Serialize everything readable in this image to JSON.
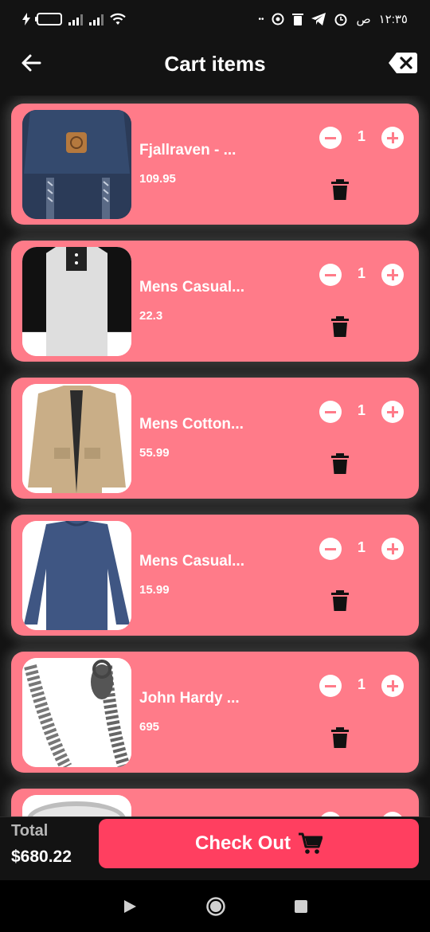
{
  "status_bar": {
    "battery": "11",
    "time": "١٢:٣٥",
    "period": "ص",
    "dots": "••"
  },
  "header": {
    "title": "Cart items",
    "back_icon": "arrow-left-icon",
    "clear_icon": "backspace-x-icon"
  },
  "cart_items": [
    {
      "title": "Fjallraven - ...",
      "price": "109.95",
      "quantity": "1",
      "image": "backpack"
    },
    {
      "title": "Mens Casual...",
      "price": "22.3",
      "quantity": "1",
      "image": "raglan-tshirt"
    },
    {
      "title": "Mens Cotton...",
      "price": "55.99",
      "quantity": "1",
      "image": "cotton-jacket"
    },
    {
      "title": "Mens Casual...",
      "price": "15.99",
      "quantity": "1",
      "image": "slim-longsleeve"
    },
    {
      "title": "John Hardy ...",
      "price": "695",
      "quantity": "1",
      "image": "dragon-bracelet"
    },
    {
      "title": "",
      "price": "",
      "quantity": "",
      "image": "ring"
    }
  ],
  "footer": {
    "total_label": "Total",
    "total_value": "$680.22",
    "checkout_label": "Check Out",
    "checkout_icon": "cart-icon"
  },
  "colors": {
    "background": "#131313",
    "card": "#ff7b89",
    "checkout": "#ff3f60"
  }
}
